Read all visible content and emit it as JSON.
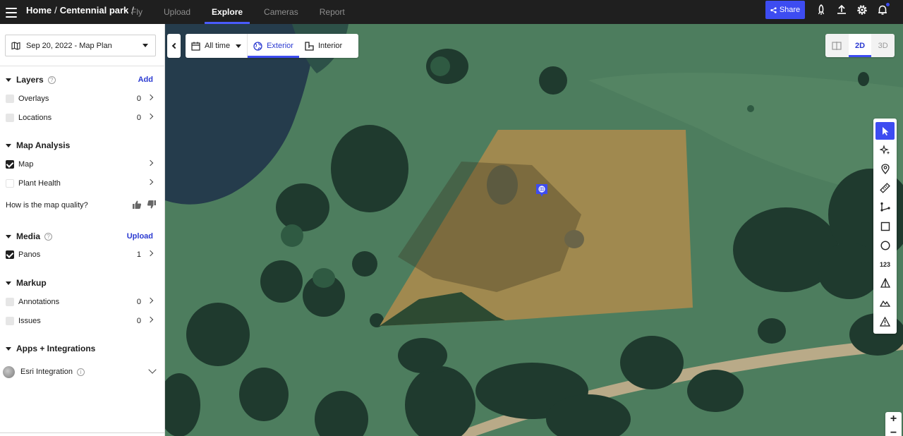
{
  "topbar": {
    "breadcrumb": [
      "Home",
      "Centennial park"
    ],
    "breadcrumb_sep": "/",
    "tabs": [
      {
        "label": "Fly",
        "active": false
      },
      {
        "label": "Upload",
        "active": false
      },
      {
        "label": "Explore",
        "active": true
      },
      {
        "label": "Cameras",
        "active": false
      },
      {
        "label": "Report",
        "active": false
      }
    ],
    "share_label": "Share",
    "icons": [
      "hamburger-icon",
      "rocket-icon",
      "upload-icon",
      "gear-icon",
      "bell-icon"
    ],
    "accent": "#3d4cf1"
  },
  "sidebar": {
    "plan_label": "Sep 20, 2022 - Map Plan",
    "layers": {
      "title": "Layers",
      "help": "?",
      "action": "Add",
      "items": [
        {
          "label": "Overlays",
          "count": "0",
          "checked": false
        },
        {
          "label": "Locations",
          "count": "0",
          "checked": false
        }
      ]
    },
    "analysis": {
      "title": "Map Analysis",
      "items": [
        {
          "label": "Map",
          "checked": true
        },
        {
          "label": "Plant Health",
          "checked": false
        }
      ],
      "quality_question": "How is the map quality?"
    },
    "media": {
      "title": "Media",
      "help": "?",
      "action": "Upload",
      "items": [
        {
          "label": "Panos",
          "count": "1",
          "checked": true
        }
      ]
    },
    "markup": {
      "title": "Markup",
      "items": [
        {
          "label": "Annotations",
          "count": "0",
          "checked": false
        },
        {
          "label": "Issues",
          "count": "0",
          "checked": false
        }
      ]
    },
    "apps": {
      "title": "Apps + Integrations",
      "esri_label": "Esri Integration",
      "help": "i"
    }
  },
  "map": {
    "time_filter": "All time",
    "tabs": [
      {
        "label": "Exterior",
        "active": true
      },
      {
        "label": "Interior",
        "active": false
      }
    ],
    "view_modes": [
      {
        "label": "2D",
        "active": true
      },
      {
        "label": "3D",
        "active": false
      }
    ],
    "tools": [
      "select-tool",
      "magic-tool",
      "location-pin-tool",
      "ruler-tool",
      "polyline-tool",
      "rectangle-tool",
      "circle-tool",
      "count-tool",
      "volume-tool",
      "elevation-tool",
      "warning-tool"
    ],
    "count_tool_label": "123",
    "zoom_in": "+",
    "zoom_out": "−"
  }
}
